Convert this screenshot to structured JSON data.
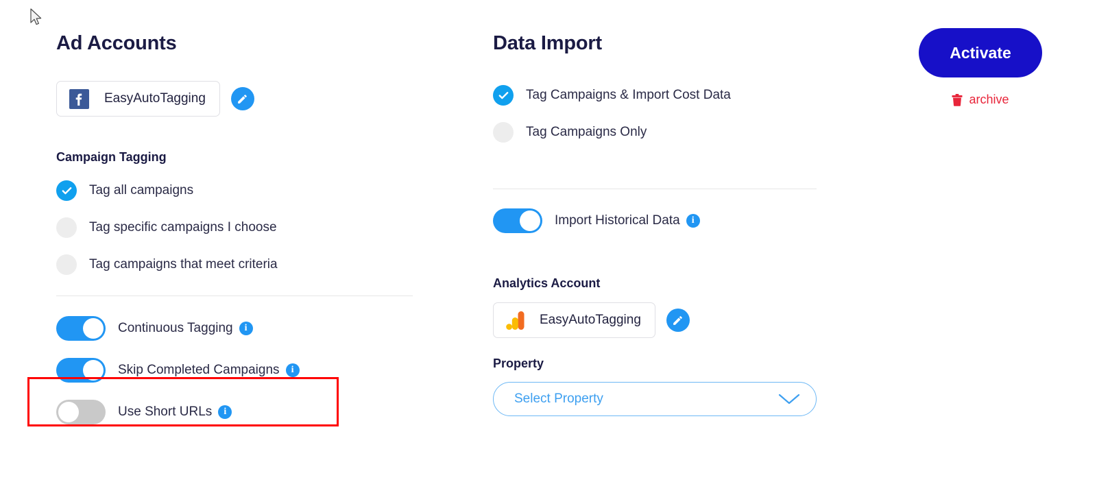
{
  "left_panel": {
    "title": "Ad Accounts",
    "ad_account": {
      "icon": "facebook-icon",
      "name": "EasyAutoTagging",
      "edit_icon": "pencil-icon"
    },
    "campaign_tagging": {
      "title": "Campaign Tagging",
      "options": [
        {
          "label": "Tag all campaigns",
          "selected": true
        },
        {
          "label": "Tag specific campaigns I choose",
          "selected": false
        },
        {
          "label": "Tag campaigns that meet criteria",
          "selected": false
        }
      ]
    },
    "toggles": [
      {
        "label": "Continuous Tagging",
        "on": true,
        "info": "i"
      },
      {
        "label": "Skip Completed Campaigns",
        "on": true,
        "info": "i"
      },
      {
        "label": "Use Short URLs",
        "on": false,
        "info": "i"
      }
    ]
  },
  "middle_panel": {
    "title": "Data Import",
    "options": [
      {
        "label": "Tag Campaigns & Import Cost Data",
        "selected": true
      },
      {
        "label": "Tag Campaigns Only",
        "selected": false
      }
    ],
    "historical_toggle": {
      "label": "Import Historical Data",
      "on": true,
      "info": "i"
    },
    "analytics_account": {
      "title": "Analytics Account",
      "icon": "google-analytics-icon",
      "name": "EasyAutoTagging",
      "edit_icon": "pencil-icon"
    },
    "property": {
      "title": "Property",
      "placeholder": "Select Property",
      "chevron": "chevron-down-icon"
    }
  },
  "right_panel": {
    "activate_label": "Activate",
    "archive_label": "archive",
    "archive_icon": "trash-icon"
  },
  "colors": {
    "accent_blue": "#2196f3",
    "activate_blue": "#1710c8",
    "archive_red": "#e8253a",
    "highlight_red": "#ff0000",
    "heading_navy": "#1b1b44",
    "toggle_off_gray": "#c9c9c9",
    "radio_off_gray": "#ededed"
  }
}
